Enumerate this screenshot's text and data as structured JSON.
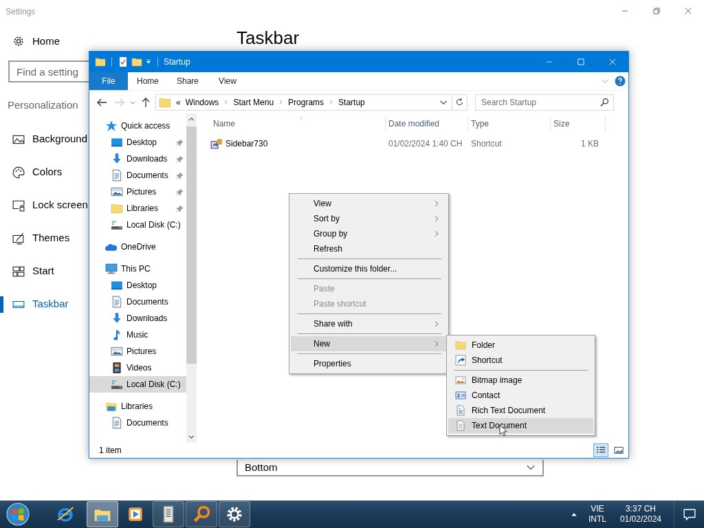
{
  "settings": {
    "title": "Settings",
    "home": "Home",
    "search": {
      "placeholder": "Find a setting"
    },
    "section": "Personalization",
    "nav": [
      {
        "label": "Background",
        "kind": "background",
        "selected": false
      },
      {
        "label": "Colors",
        "kind": "colors",
        "selected": false
      },
      {
        "label": "Lock screen",
        "kind": "lock",
        "selected": false
      },
      {
        "label": "Themes",
        "kind": "themes",
        "selected": false
      },
      {
        "label": "Start",
        "kind": "start",
        "selected": false
      },
      {
        "label": "Taskbar",
        "kind": "taskbar",
        "selected": true
      }
    ],
    "page_title": "Taskbar",
    "position_dropdown": {
      "value": "Bottom"
    }
  },
  "explorer": {
    "title": "Startup",
    "file_tab": "File",
    "ribbon_tabs": [
      "Home",
      "Share",
      "View"
    ],
    "address": {
      "overflow": "«",
      "path": [
        "Windows",
        "Start Menu",
        "Programs",
        "Startup"
      ]
    },
    "search": {
      "placeholder": "Search Startup"
    },
    "nav_pane": [
      {
        "label": "Quick access",
        "kind": "star",
        "selected": false,
        "children": [
          {
            "label": "Desktop",
            "kind": "desktop",
            "pinned": true,
            "selected": false
          },
          {
            "label": "Downloads",
            "kind": "downloads",
            "pinned": true,
            "selected": false
          },
          {
            "label": "Documents",
            "kind": "documents",
            "pinned": true,
            "selected": false
          },
          {
            "label": "Pictures",
            "kind": "pictures",
            "pinned": true,
            "selected": false
          },
          {
            "label": "Libraries",
            "kind": "folder",
            "pinned": true,
            "selected": false
          },
          {
            "label": "Local Disk (C:)",
            "kind": "drive",
            "pinned": false,
            "selected": false
          }
        ]
      },
      {
        "label": "OneDrive",
        "kind": "cloud",
        "selected": false
      },
      {
        "label": "This PC",
        "kind": "pc",
        "selected": false,
        "children": [
          {
            "label": "Desktop",
            "kind": "desktop",
            "selected": false
          },
          {
            "label": "Documents",
            "kind": "documents",
            "selected": false
          },
          {
            "label": "Downloads",
            "kind": "downloads",
            "selected": false
          },
          {
            "label": "Music",
            "kind": "music",
            "selected": false
          },
          {
            "label": "Pictures",
            "kind": "pictures",
            "selected": false
          },
          {
            "label": "Videos",
            "kind": "videos",
            "selected": false
          },
          {
            "label": "Local Disk (C:)",
            "kind": "drive",
            "selected": true
          }
        ]
      },
      {
        "label": "Libraries",
        "kind": "library",
        "selected": false,
        "children": [
          {
            "label": "Documents",
            "kind": "documents",
            "selected": false
          }
        ]
      }
    ],
    "columns": [
      {
        "label": "Name",
        "sorted": true
      },
      {
        "label": "Date modified",
        "sorted": false
      },
      {
        "label": "Type",
        "sorted": false
      },
      {
        "label": "Size",
        "sorted": false
      }
    ],
    "rows": [
      {
        "name": "Sidebar730",
        "date": "01/02/2024 1:40 CH",
        "type": "Shortcut",
        "size": "1 KB"
      }
    ],
    "status": "1 item",
    "view_buttons": [
      {
        "kind": "details",
        "selected": true
      },
      {
        "kind": "large",
        "selected": false
      }
    ]
  },
  "context_menu": [
    {
      "kind": "item",
      "label": "View",
      "submenu": true,
      "disabled": false,
      "selected": false
    },
    {
      "kind": "item",
      "label": "Sort by",
      "submenu": true,
      "disabled": false,
      "selected": false
    },
    {
      "kind": "item",
      "label": "Group by",
      "submenu": true,
      "disabled": false,
      "selected": false
    },
    {
      "kind": "item",
      "label": "Refresh",
      "submenu": false,
      "disabled": false,
      "selected": false
    },
    {
      "kind": "separator"
    },
    {
      "kind": "item",
      "label": "Customize this folder...",
      "submenu": false,
      "disabled": false,
      "selected": false
    },
    {
      "kind": "separator"
    },
    {
      "kind": "item",
      "label": "Paste",
      "submenu": false,
      "disabled": true,
      "selected": false
    },
    {
      "kind": "item",
      "label": "Paste shortcut",
      "submenu": false,
      "disabled": true,
      "selected": false
    },
    {
      "kind": "separator"
    },
    {
      "kind": "item",
      "label": "Share with",
      "submenu": true,
      "disabled": false,
      "selected": false
    },
    {
      "kind": "separator"
    },
    {
      "kind": "item",
      "label": "New",
      "submenu": true,
      "disabled": false,
      "selected": true
    },
    {
      "kind": "separator"
    },
    {
      "kind": "item",
      "label": "Properties",
      "submenu": false,
      "disabled": false,
      "selected": false
    }
  ],
  "new_submenu": [
    {
      "kind": "folder",
      "label": "Folder",
      "selected": false
    },
    {
      "kind": "shortcut",
      "label": "Shortcut",
      "selected": false
    },
    {
      "kind": "separator"
    },
    {
      "kind": "bitmap",
      "label": "Bitmap image",
      "selected": false
    },
    {
      "kind": "contact",
      "label": "Contact",
      "selected": false
    },
    {
      "kind": "richtext",
      "label": "Rich Text Document",
      "selected": false
    },
    {
      "kind": "text",
      "label": "Text Document",
      "selected": true
    }
  ],
  "taskbar": {
    "apps": [
      {
        "kind": "browser",
        "running": false,
        "active": false
      },
      {
        "kind": "explorer",
        "running": true,
        "active": true
      },
      {
        "kind": "media",
        "running": false,
        "active": false
      },
      {
        "kind": "files",
        "running": true,
        "active": false
      },
      {
        "kind": "search",
        "running": true,
        "active": false
      },
      {
        "kind": "settings",
        "running": true,
        "active": false
      }
    ],
    "language": [
      "VIE",
      "INTL"
    ],
    "time": "3:37 CH",
    "date": "01/02/2024"
  }
}
